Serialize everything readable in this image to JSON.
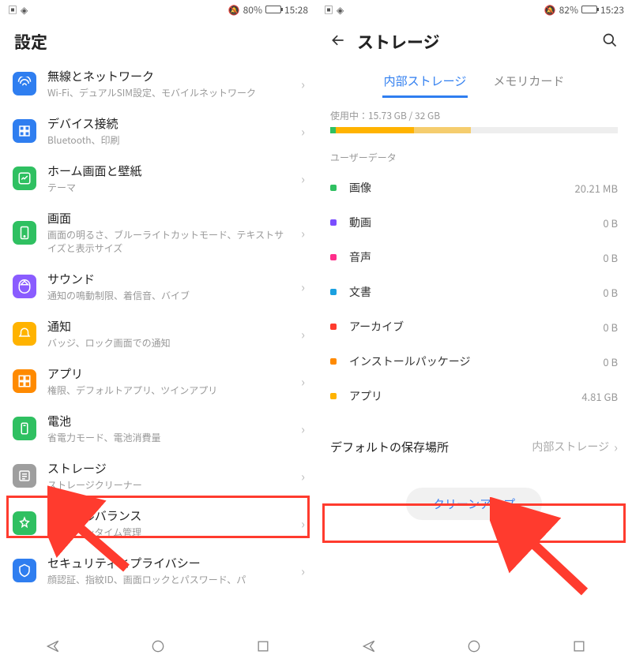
{
  "left": {
    "status": {
      "battery": "80%",
      "time": "15:28"
    },
    "title": "設定",
    "items": [
      {
        "title": "無線とネットワーク",
        "sub": "Wi-Fi、デュアルSIM設定、モバイルネットワーク",
        "color": "#2f7ef0"
      },
      {
        "title": "デバイス接続",
        "sub": "Bluetooth、印刷",
        "color": "#2f7ef0"
      },
      {
        "title": "ホーム画面と壁紙",
        "sub": "テーマ",
        "color": "#2fc061"
      },
      {
        "title": "画面",
        "sub": "画面の明るさ、ブルーライトカットモード、テキストサイズと表示サイズ",
        "color": "#2fc061"
      },
      {
        "title": "サウンド",
        "sub": "通知の鳴動制限、着信音、バイブ",
        "color": "#8a5cff"
      },
      {
        "title": "通知",
        "sub": "バッジ、ロック画面での通知",
        "color": "#ffb300"
      },
      {
        "title": "アプリ",
        "sub": "権限、デフォルトアプリ、ツインアプリ",
        "color": "#ff8a00"
      },
      {
        "title": "電池",
        "sub": "省電力モード、電池消費量",
        "color": "#2fc061"
      },
      {
        "title": "ストレージ",
        "sub": "ストレージクリーナー",
        "color": "#9e9e9e"
      },
      {
        "title": "デジタルバランス",
        "sub": "スクリーンタイム管理",
        "color": "#2fc061"
      },
      {
        "title": "セキュリティとプライバシー",
        "sub": "顔認証、指紋ID、画面ロックとパスワード、パ",
        "color": "#2f7ef0"
      }
    ]
  },
  "right": {
    "status": {
      "battery": "82%",
      "time": "15:23"
    },
    "title": "ストレージ",
    "tabs": {
      "active": "内部ストレージ",
      "other": "メモリカード"
    },
    "usage": {
      "label_prefix": "使用中：",
      "used": "15.73 GB",
      "sep": " / ",
      "total": "32 GB",
      "used_pct": 49
    },
    "section_label": "ユーザーデータ",
    "categories": [
      {
        "name": "画像",
        "value": "20.21 MB",
        "color": "#2fc061"
      },
      {
        "name": "動画",
        "value": "0 B",
        "color": "#7a4dff"
      },
      {
        "name": "音声",
        "value": "0 B",
        "color": "#ff2e8a"
      },
      {
        "name": "文書",
        "value": "0 B",
        "color": "#1aa0e0"
      },
      {
        "name": "アーカイブ",
        "value": "0 B",
        "color": "#ff3b2e"
      },
      {
        "name": "インストールパッケージ",
        "value": "0 B",
        "color": "#ff8a00"
      },
      {
        "name": "アプリ",
        "value": "4.81 GB",
        "color": "#ffb300"
      }
    ],
    "default_location": {
      "label": "デフォルトの保存場所",
      "value": "内部ストレージ"
    },
    "cleanup_label": "クリーンアップ"
  }
}
